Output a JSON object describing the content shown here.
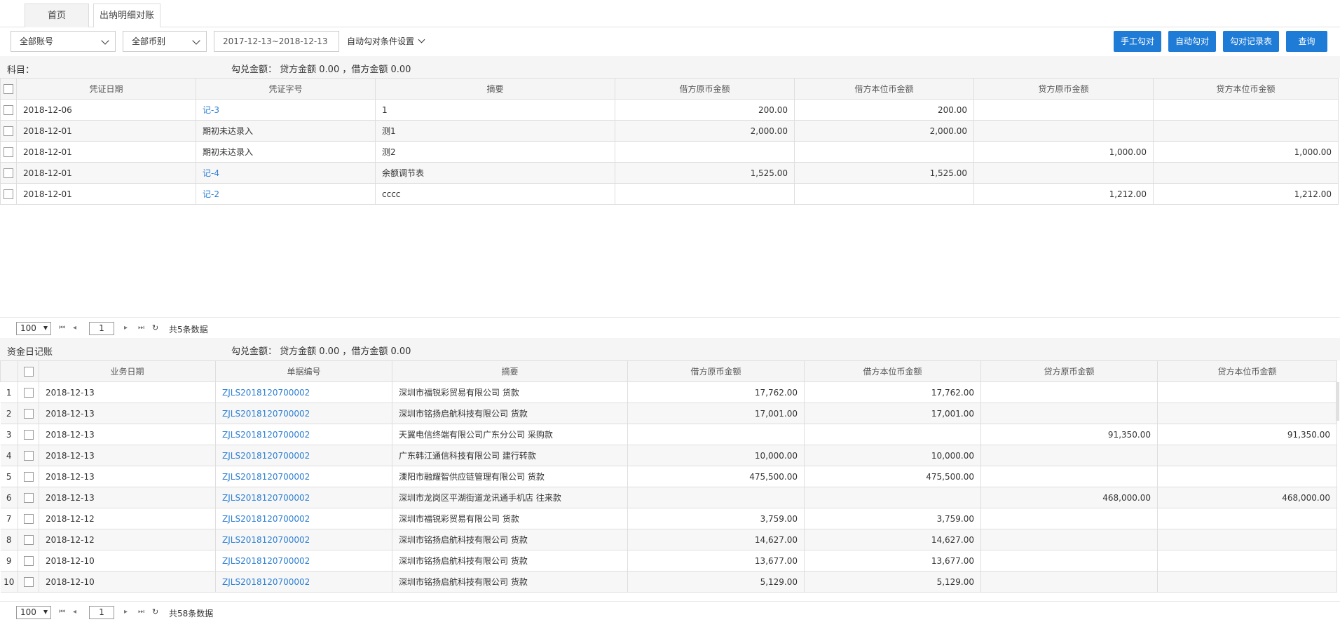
{
  "tabs": [
    {
      "label": "首页"
    },
    {
      "label": "出纳明细对账"
    }
  ],
  "toolbar": {
    "account_select": "全部账号",
    "currency_select": "全部币别",
    "date_range": "2017-12-13~2018-12-13",
    "auto_settings": "自动勾对条件设置",
    "btn_manual": "手工勾对",
    "btn_auto": "自动勾对",
    "btn_records": "勾对记录表",
    "btn_query": "查询"
  },
  "upper": {
    "subject_label": "科目：",
    "amount_text": "勾兑金额： 贷方金额 0.00 ，借方金额 0.00",
    "headers": [
      "凭证日期",
      "凭证字号",
      "摘要",
      "借方原币金额",
      "借方本位币金额",
      "贷方原币金额",
      "贷方本位币金额"
    ],
    "rows": [
      {
        "date": "2018-12-06",
        "voucher": "记-3",
        "link": true,
        "summary": "1",
        "dr_orig": "200.00",
        "dr_base": "200.00",
        "cr_orig": "",
        "cr_base": ""
      },
      {
        "date": "2018-12-01",
        "voucher": "期初未达录入",
        "link": false,
        "summary": "测1",
        "dr_orig": "2,000.00",
        "dr_base": "2,000.00",
        "cr_orig": "",
        "cr_base": ""
      },
      {
        "date": "2018-12-01",
        "voucher": "期初未达录入",
        "link": false,
        "summary": "测2",
        "dr_orig": "",
        "dr_base": "",
        "cr_orig": "1,000.00",
        "cr_base": "1,000.00"
      },
      {
        "date": "2018-12-01",
        "voucher": "记-4",
        "link": true,
        "summary": "余额调节表",
        "dr_orig": "1,525.00",
        "dr_base": "1,525.00",
        "cr_orig": "",
        "cr_base": ""
      },
      {
        "date": "2018-12-01",
        "voucher": "记-2",
        "link": true,
        "summary": "cccc",
        "dr_orig": "",
        "dr_base": "",
        "cr_orig": "1,212.00",
        "cr_base": "1,212.00"
      }
    ],
    "pager": {
      "page_size": "100",
      "page": "1",
      "total": "共5条数据"
    }
  },
  "lower": {
    "title": "资金日记账",
    "amount_text": "勾兑金额： 贷方金额 0.00 ，借方金额 0.00",
    "headers": [
      "业务日期",
      "单据编号",
      "摘要",
      "借方原币金额",
      "借方本位币金额",
      "贷方原币金额",
      "贷方本位币金额"
    ],
    "rows": [
      {
        "idx": "1",
        "date": "2018-12-13",
        "doc": "ZJLS2018120700002",
        "summary": "深圳市福锐彩贸易有限公司 货款",
        "dr_orig": "17,762.00",
        "dr_base": "17,762.00",
        "cr_orig": "",
        "cr_base": ""
      },
      {
        "idx": "2",
        "date": "2018-12-13",
        "doc": "ZJLS2018120700002",
        "summary": "深圳市铭扬启航科技有限公司 货款",
        "dr_orig": "17,001.00",
        "dr_base": "17,001.00",
        "cr_orig": "",
        "cr_base": ""
      },
      {
        "idx": "3",
        "date": "2018-12-13",
        "doc": "ZJLS2018120700002",
        "summary": "天翼电信终端有限公司广东分公司 采购款",
        "dr_orig": "",
        "dr_base": "",
        "cr_orig": "91,350.00",
        "cr_base": "91,350.00"
      },
      {
        "idx": "4",
        "date": "2018-12-13",
        "doc": "ZJLS2018120700002",
        "summary": "广东韩江通信科技有限公司 建行转款",
        "dr_orig": "10,000.00",
        "dr_base": "10,000.00",
        "cr_orig": "",
        "cr_base": ""
      },
      {
        "idx": "5",
        "date": "2018-12-13",
        "doc": "ZJLS2018120700002",
        "summary": "溧阳市融耀智供应链管理有限公司 货款",
        "dr_orig": "475,500.00",
        "dr_base": "475,500.00",
        "cr_orig": "",
        "cr_base": ""
      },
      {
        "idx": "6",
        "date": "2018-12-13",
        "doc": "ZJLS2018120700002",
        "summary": "深圳市龙岗区平湖街道龙讯通手机店 往来款",
        "dr_orig": "",
        "dr_base": "",
        "cr_orig": "468,000.00",
        "cr_base": "468,000.00"
      },
      {
        "idx": "7",
        "date": "2018-12-12",
        "doc": "ZJLS2018120700002",
        "summary": "深圳市福锐彩贸易有限公司 货款",
        "dr_orig": "3,759.00",
        "dr_base": "3,759.00",
        "cr_orig": "",
        "cr_base": ""
      },
      {
        "idx": "8",
        "date": "2018-12-12",
        "doc": "ZJLS2018120700002",
        "summary": "深圳市铭扬启航科技有限公司 货款",
        "dr_orig": "14,627.00",
        "dr_base": "14,627.00",
        "cr_orig": "",
        "cr_base": ""
      },
      {
        "idx": "9",
        "date": "2018-12-10",
        "doc": "ZJLS2018120700002",
        "summary": "深圳市铭扬启航科技有限公司 货款",
        "dr_orig": "13,677.00",
        "dr_base": "13,677.00",
        "cr_orig": "",
        "cr_base": ""
      },
      {
        "idx": "10",
        "date": "2018-12-10",
        "doc": "ZJLS2018120700002",
        "summary": "深圳市铭扬启航科技有限公司 货款",
        "dr_orig": "5,129.00",
        "dr_base": "5,129.00",
        "cr_orig": "",
        "cr_base": ""
      }
    ],
    "pager": {
      "page_size": "100",
      "page": "1",
      "total": "共58条数据"
    }
  },
  "colors": {
    "accent": "#1e7bd6",
    "link": "#2c7fd4"
  }
}
